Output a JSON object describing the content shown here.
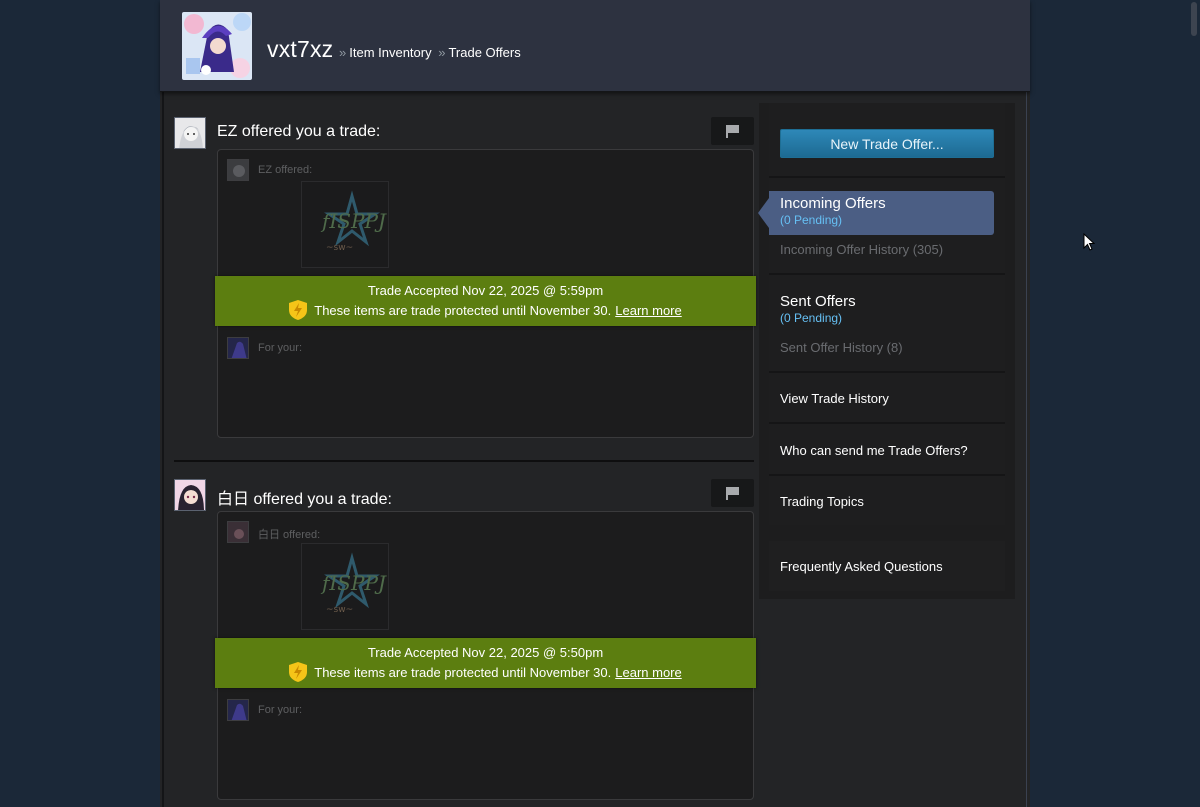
{
  "header": {
    "persona": "vxt7xz",
    "breadcrumbs": [
      "Item Inventory",
      "Trade Offers"
    ]
  },
  "offers": [
    {
      "title": "EZ offered you a trade:",
      "offered_label": "EZ offered:",
      "accepted_text": "Trade Accepted Nov 22, 2025 @ 5:59pm",
      "protected_text": "These items are trade protected until November 30.",
      "learn_more": "Learn more",
      "for_your_label": "For your:"
    },
    {
      "title": "白日 offered you a trade:",
      "offered_label": "白日 offered:",
      "accepted_text": "Trade Accepted Nov 22, 2025 @ 5:50pm",
      "protected_text": "These items are trade protected until November 30.",
      "learn_more": "Learn more",
      "for_your_label": "For your:"
    }
  ],
  "sidebar": {
    "new_offer_button": "New Trade Offer...",
    "incoming_title": "Incoming Offers",
    "incoming_pending": "(0 Pending)",
    "incoming_history": "Incoming Offer History (305)",
    "sent_title": "Sent Offers",
    "sent_pending": "(0 Pending)",
    "sent_history": "Sent Offer History (8)",
    "view_history": "View Trade History",
    "who_can_send": "Who can send me Trade Offers?",
    "trading_topics": "Trading Topics",
    "faq": "Frequently Asked Questions"
  },
  "colors": {
    "background": "#1b2838",
    "accepted_banner": "#5c7e10",
    "active_tab": "#4b5e84",
    "pending_blue": "#66c0f4",
    "button_blue": "#1d6a92"
  },
  "icons": {
    "flag": "flag-icon",
    "shield": "trade-protected-shield-icon",
    "cursor": "mouse-pointer-icon"
  }
}
